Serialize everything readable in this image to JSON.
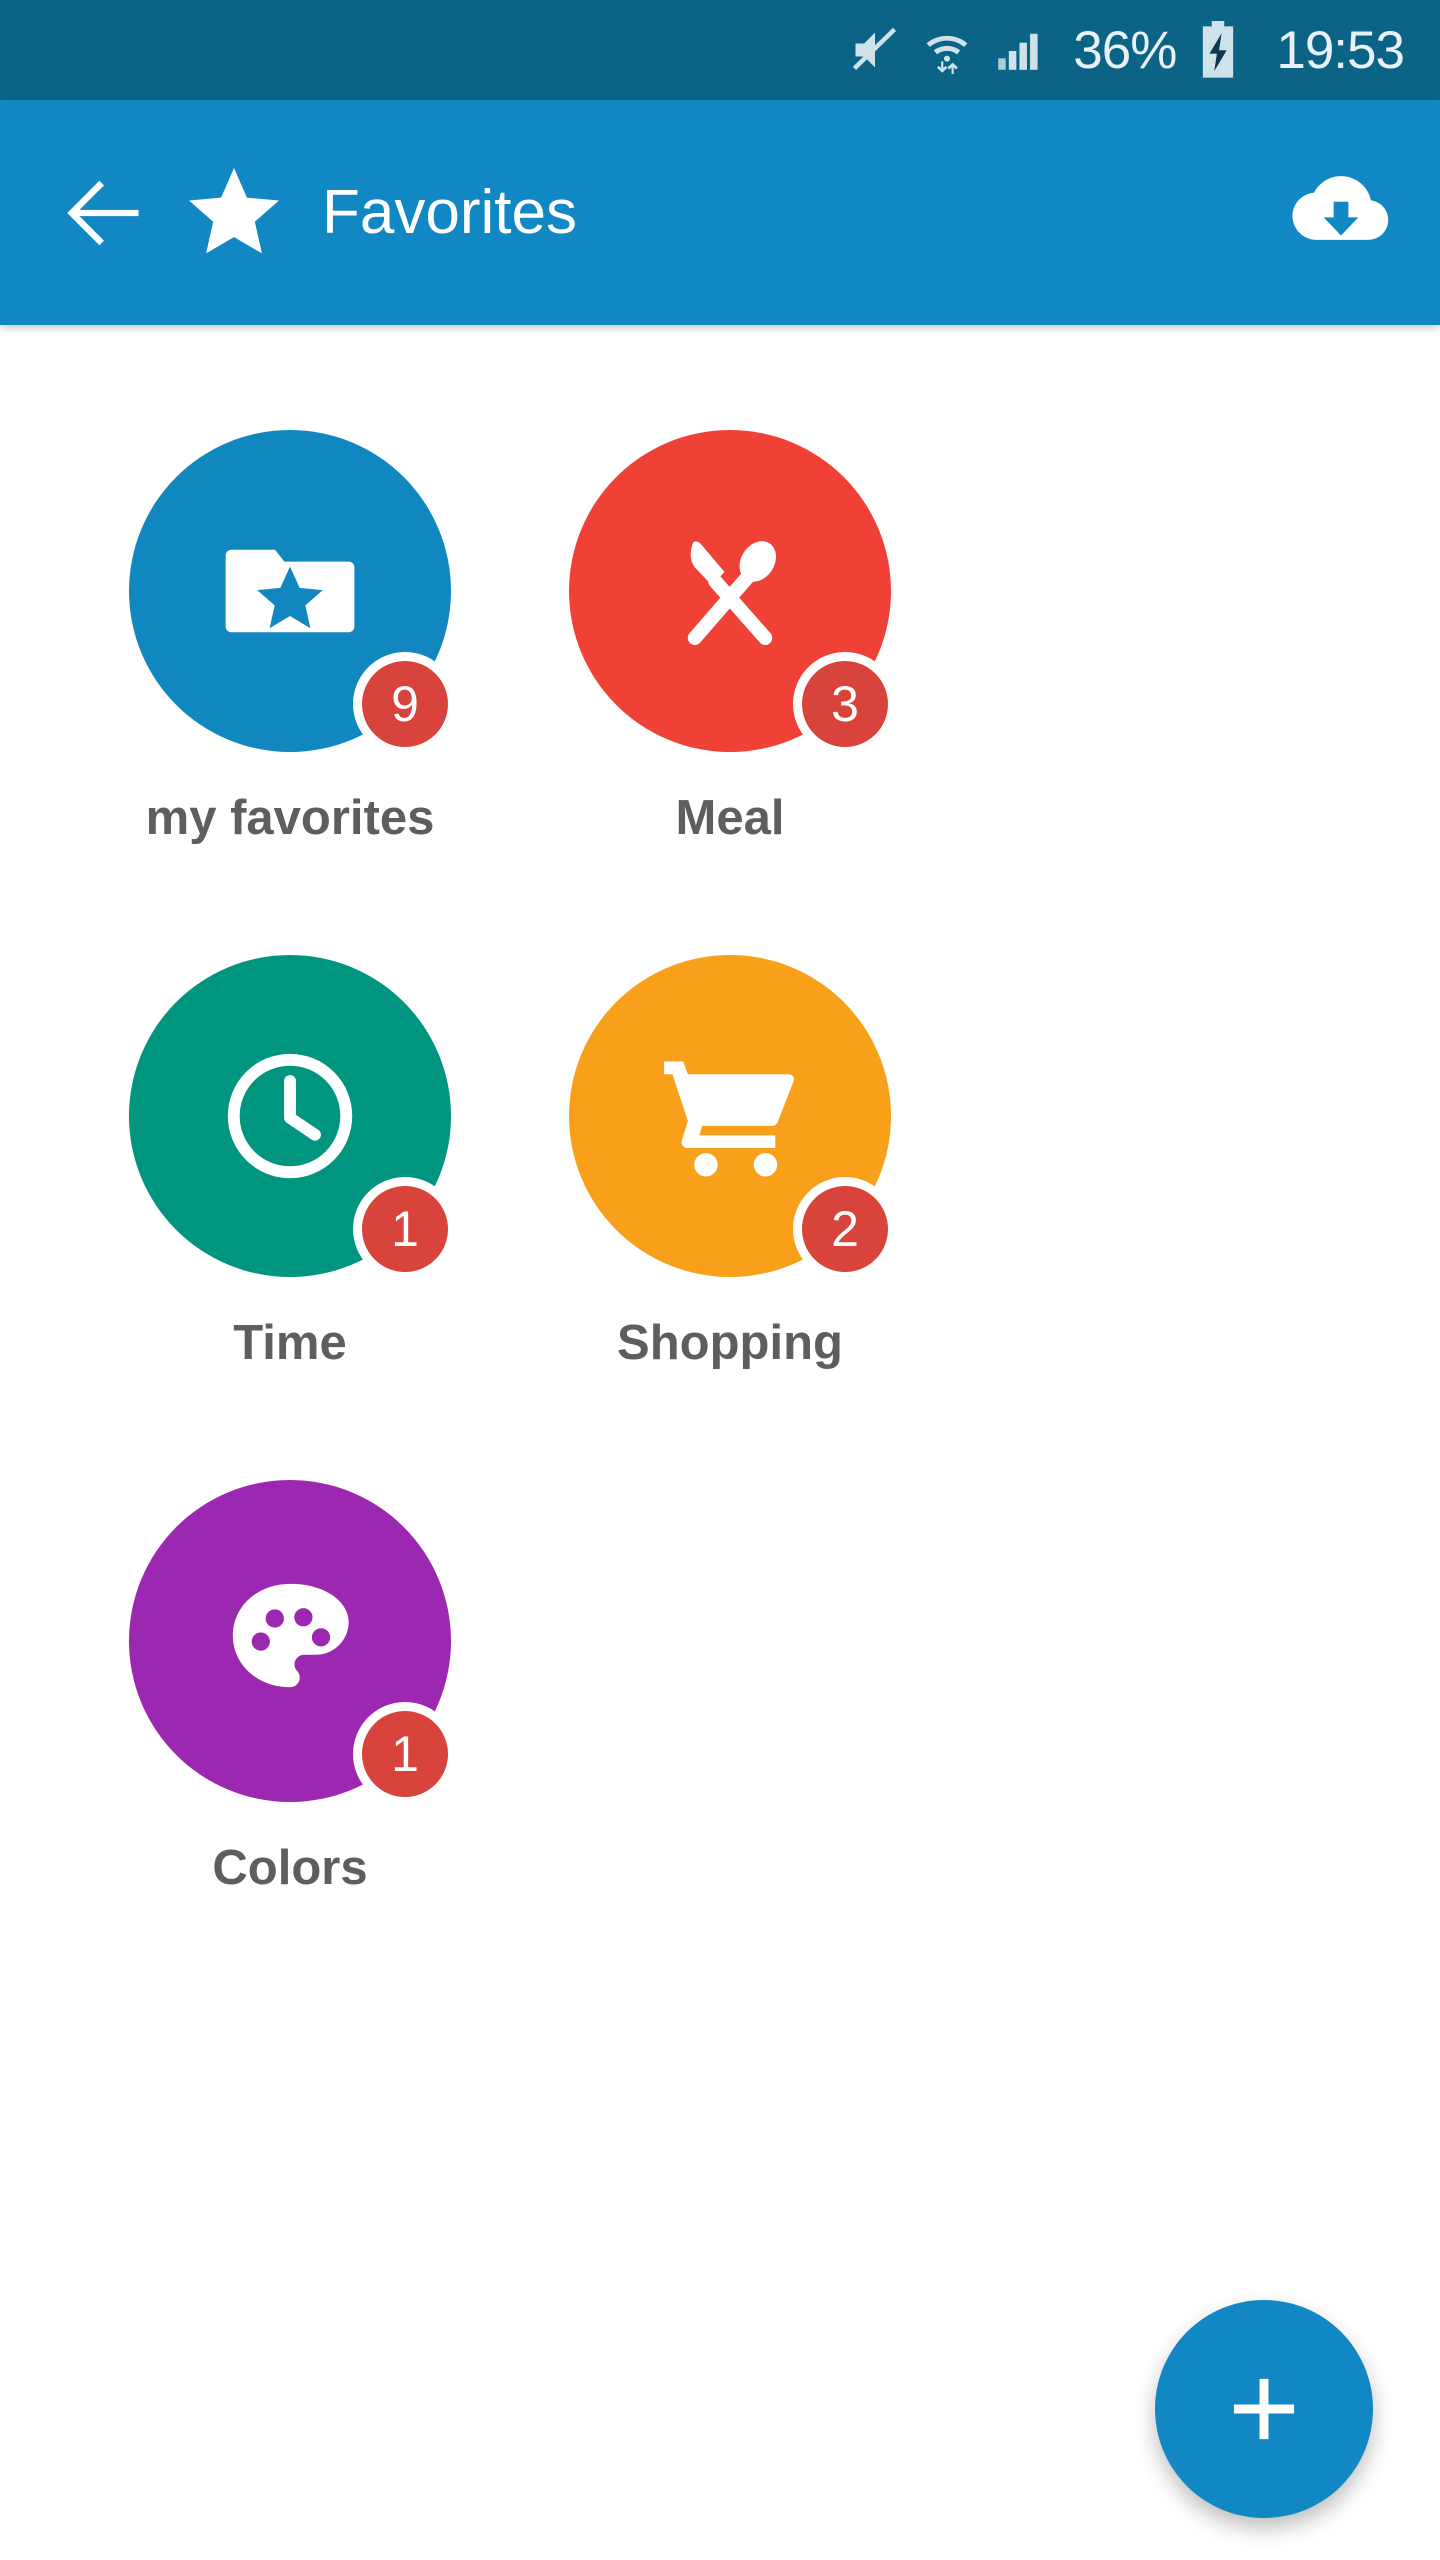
{
  "status_bar": {
    "mute_icon": "volume-mute-icon",
    "wifi_icon": "wifi-data-transfer-icon",
    "signal_icon": "cellular-signal-icon",
    "battery_percent": "36%",
    "battery_icon": "battery-charging-icon",
    "clock": "19:53",
    "background_color": "#0B6386",
    "text_color": "#E8F2F6"
  },
  "app_bar": {
    "back_icon": "arrow-left-icon",
    "brand_icon": "star-icon",
    "title": "Favorites",
    "action_icon": "cloud-download-icon",
    "background_color": "#1187C4",
    "text_color": "#FFFFFF"
  },
  "content": {
    "background_color": "#FFFFFF",
    "label_color": "#5E5E5E",
    "badge_color": "#D8443C",
    "items": [
      {
        "label": "my favorites",
        "badge": "9",
        "color": "#1187BF",
        "icon": "folder-star-icon"
      },
      {
        "label": "Meal",
        "badge": "3",
        "color": "#EF4136",
        "icon": "cutlery-knife-spoon-icon"
      },
      {
        "label": "Time",
        "badge": "1",
        "color": "#00957F",
        "icon": "clock-icon"
      },
      {
        "label": "Shopping",
        "badge": "2",
        "color": "#F9A01B",
        "icon": "shopping-cart-icon"
      },
      {
        "label": "Colors",
        "badge": "1",
        "color": "#9C27B0",
        "icon": "paint-palette-icon"
      }
    ]
  },
  "fab": {
    "icon": "plus-icon",
    "color": "#1187C4"
  }
}
